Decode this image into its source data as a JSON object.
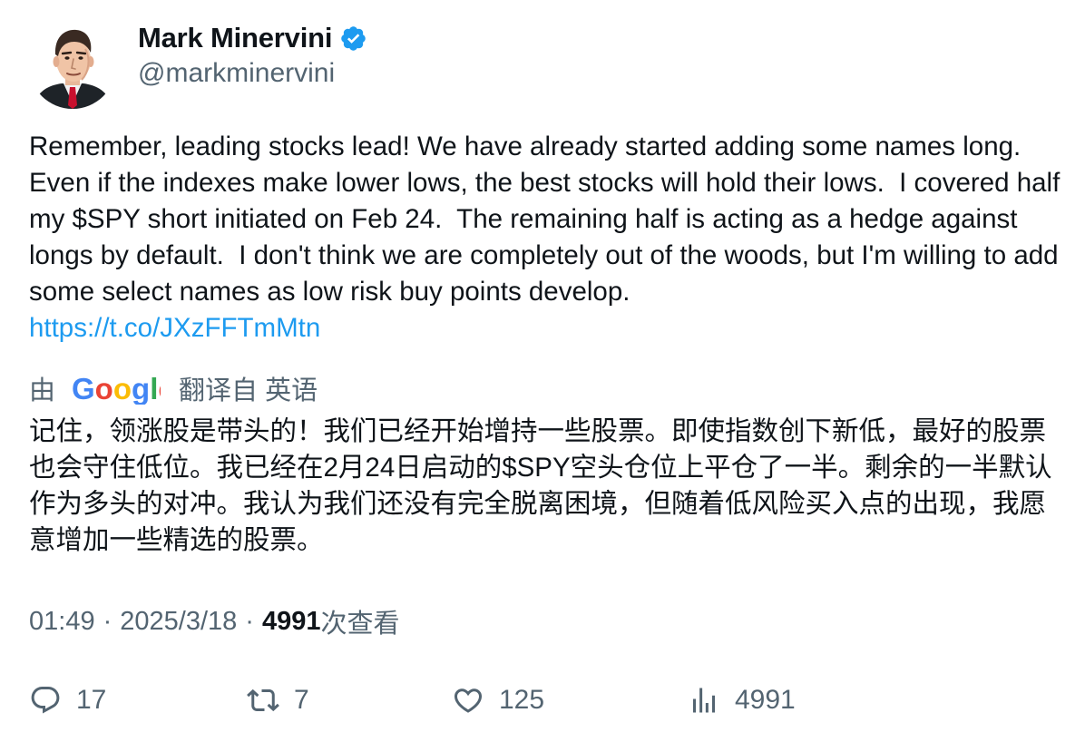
{
  "author": {
    "display_name": "Mark Minervini",
    "handle": "@markminervini",
    "avatar_icon": "cartoon-portrait-avatar",
    "verified_icon": "verified-badge-icon",
    "verified_color": "#1d9bf0"
  },
  "tweet": {
    "text": "Remember, leading stocks lead! We have already started adding some names long. Even if the indexes make lower lows, the best stocks will hold their lows.  I covered half my $SPY short initiated on Feb 24.  The remaining half is acting as a hedge against longs by default.  I don't think we are completely out of the woods, but I'm willing to add some select names as low risk buy points develop.",
    "link": "https://t.co/JXzFFTmMtn",
    "link_color": "#1d9bf0"
  },
  "translation": {
    "prefix": "由",
    "provider_logo": "Google",
    "suffix": "翻译自 英语",
    "text": "记住，领涨股是带头的！我们已经开始增持一些股票。即使指数创下新低，最好的股票也会守住低位。我已经在2月24日启动的$SPY空头仓位上平仓了一半。剩余的一半默认作为多头的对冲。我认为我们还没有完全脱离困境，但随着低风险买入点的出现，我愿意增加一些精选的股票。"
  },
  "meta": {
    "time": "01:49",
    "separator": "·",
    "date": "2025/3/18",
    "views_count": "4991",
    "views_label": "次查看"
  },
  "actions": {
    "reply": {
      "icon": "reply-icon",
      "count": "17"
    },
    "repost": {
      "icon": "repost-icon",
      "count": "7"
    },
    "like": {
      "icon": "heart-icon",
      "count": "125"
    },
    "views": {
      "icon": "views-chart-icon",
      "count": "4991"
    }
  },
  "colors": {
    "text_primary": "#0f1419",
    "text_secondary": "#536471"
  }
}
